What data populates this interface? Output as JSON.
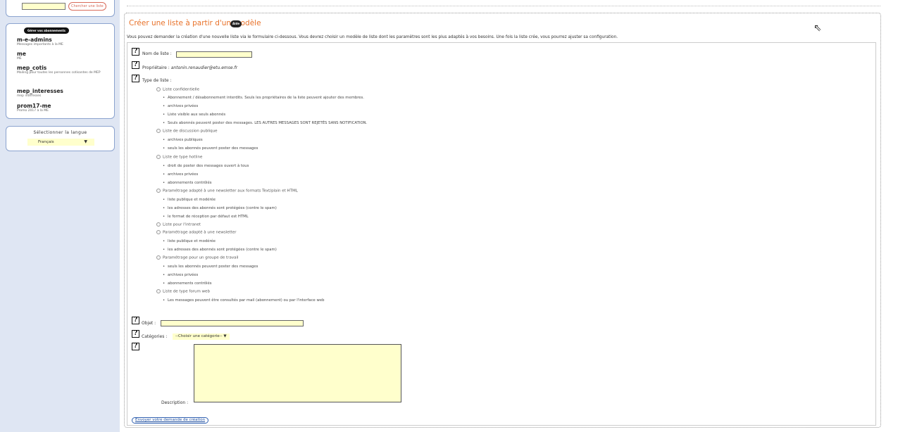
{
  "left": {
    "search_button": "Chercher une liste",
    "lists_header": "Gérer vos abonnements",
    "lists": [
      {
        "name": "m-e-admins",
        "desc": "Messages importants à la ME"
      },
      {
        "name": "me",
        "desc": "ME"
      },
      {
        "name": "mep_cotis",
        "desc": "Mailing pour toutes les personnes cotisantes de MEP"
      },
      {
        "name": "mep_interesses",
        "desc": "mep interesses"
      },
      {
        "name": "prom17-me",
        "desc": "Promo 2017 à la ME"
      }
    ],
    "lang_title": "Sélectionner la langue",
    "lang_value": "Français"
  },
  "main": {
    "title": "Créer une liste à partir d'un modèle",
    "aide": "Aide",
    "intro": "Vous pouvez demander la création d'une nouvelle liste via le formulaire ci-dessous. Vous devrez choisir un modèle de liste dont les paramètres sont les plus adaptés à vos besoins. Une fois la liste crée, vous pourrez ajuster sa configuration.",
    "nom_label": "Nom de liste :",
    "owner_label": "Propriétaire :",
    "owner_value": "antonin.renaudier@etu.emse.fr",
    "type_label": "Type de liste :",
    "types": [
      {
        "label": "Liste confidentielle",
        "bullets": [
          "Abonnement / désabonnement interdits. Seuls les propriétaires de la liste peuvent ajouter des membres.",
          "archives privées",
          "Liste visible aux seuls abonnés",
          "Seuls abonnés peuvent poster des messages. LES AUTRES MESSAGES SONT REJETÉS SANS NOTIFICATION."
        ]
      },
      {
        "label": "Liste de discussion publique",
        "bullets": [
          "archives publiques",
          "seuls les abonnés peuvent poster des messages"
        ]
      },
      {
        "label": "Liste de type hotline",
        "bullets": [
          "droit de poster des messages ouvert à tous",
          "archives privées",
          "abonnements contrôlés"
        ]
      },
      {
        "label": "Paramétrage adapté à une newsletter aux formats Text/plain et HTML",
        "bullets": [
          "liste publique et modérée",
          "les adresses des abonnés sont protégées (contre le spam)",
          "le format de réception par défaut est HTML"
        ]
      },
      {
        "label": "Liste pour l'intranet",
        "bullets": []
      },
      {
        "label": "Paramétrage adapté à une newsletter",
        "bullets": [
          "liste publique et modérée",
          "les adresses des abonnés sont protégées (contre le spam)"
        ]
      },
      {
        "label": "Paramétrage pour un groupe de travail",
        "bullets": [
          "seuls les abonnés peuvent poster des messages",
          "archives privées",
          "abonnements contrôlés"
        ]
      },
      {
        "label": "Liste de type forum web",
        "bullets": [
          "Les messages peuvent être consultés par mail (abonnement) ou par l'interface web"
        ]
      }
    ],
    "objet_label": "Objet :",
    "categories_label": "Catégories :",
    "categories_value": "--Choisir une catégorie--",
    "description_label": "Description :",
    "submit": "Envoyer votre demande de création"
  }
}
